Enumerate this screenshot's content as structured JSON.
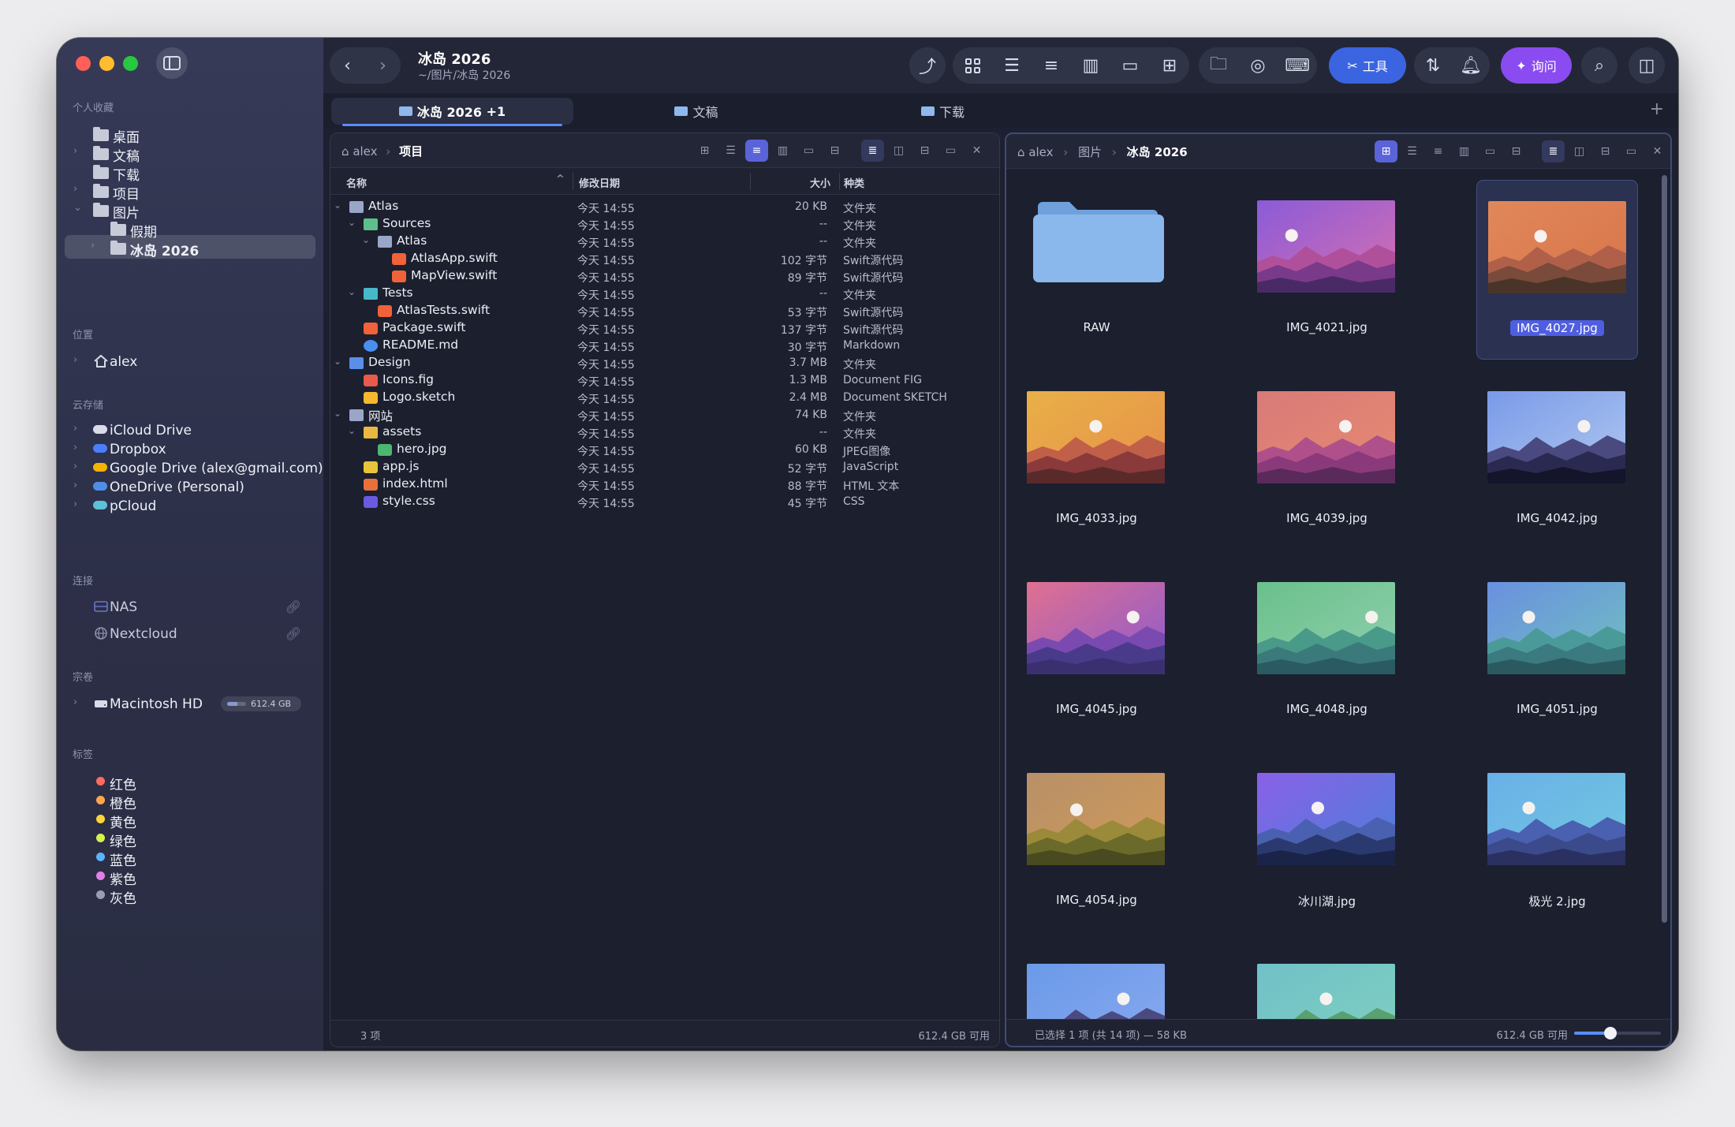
{
  "window": {
    "title": "冰岛 2026",
    "path": "~/图片/冰岛 2026"
  },
  "sidebar": {
    "favorites_header": "个人收藏",
    "favorites": [
      {
        "label": "桌面",
        "chevron": false
      },
      {
        "label": "文稿",
        "chevron": true
      },
      {
        "label": "下载",
        "chevron": false
      },
      {
        "label": "项目",
        "chevron": true
      },
      {
        "label": "图片",
        "chevron": true,
        "expanded": true
      },
      {
        "label": "假期",
        "chevron": false,
        "child": true
      },
      {
        "label": "冰岛 2026",
        "chevron": true,
        "child": true,
        "selected": true
      }
    ],
    "locations_header": "位置",
    "locations": [
      {
        "label": "alex"
      }
    ],
    "cloud_header": "云存储",
    "cloud": [
      {
        "label": "iCloud Drive",
        "icon": "cloud-icon",
        "color": "#d9dce8"
      },
      {
        "label": "Dropbox",
        "icon": "dropbox-icon",
        "color": "#4a7dff"
      },
      {
        "label": "Google Drive (alex@gmail.com)",
        "icon": "google-drive-icon",
        "color": "#f4b400"
      },
      {
        "label": "OneDrive (Personal)",
        "icon": "onedrive-icon",
        "color": "#4f8ee8"
      },
      {
        "label": "pCloud",
        "icon": "pcloud-icon",
        "color": "#5cc0d8"
      }
    ],
    "connections_header": "连接",
    "connections": [
      {
        "label": "NAS",
        "icon": "nas-icon"
      },
      {
        "label": "Nextcloud",
        "icon": "globe-icon"
      }
    ],
    "volumes_header": "宗卷",
    "volumes": [
      {
        "label": "Macintosh HD",
        "capacity": "612.4 GB",
        "usage_fraction": 0.55
      }
    ],
    "tags_header": "标签",
    "tags": [
      {
        "label": "红色",
        "color": "#ff6b5e"
      },
      {
        "label": "橙色",
        "color": "#ffa64d"
      },
      {
        "label": "黄色",
        "color": "#ffd43b"
      },
      {
        "label": "绿色",
        "color": "#d7f24d"
      },
      {
        "label": "蓝色",
        "color": "#5cb2ff"
      },
      {
        "label": "紫色",
        "color": "#e27ee8"
      },
      {
        "label": "灰色",
        "color": "#9a9eb0"
      }
    ]
  },
  "toolbar": {
    "tools_label": "工具",
    "ask_label": "询问",
    "accent_blue": "#3a64e0",
    "accent_purple": "#8a4bf0"
  },
  "tabs": [
    {
      "label": "冰岛 2026",
      "badge": "+1",
      "active": true
    },
    {
      "label": "文稿",
      "active": false
    },
    {
      "label": "下载",
      "active": false
    }
  ],
  "left_pane": {
    "breadcrumb": [
      "alex",
      "项目"
    ],
    "columns": {
      "name": "名称",
      "date": "修改日期",
      "size": "大小",
      "kind": "种类"
    },
    "rows": [
      {
        "depth": 0,
        "expanded": true,
        "icon": "folder",
        "name": "Atlas",
        "date": "今天 14:55",
        "size": "20 KB",
        "kind": "文件夹"
      },
      {
        "depth": 1,
        "expanded": true,
        "icon": "folder-green",
        "name": "Sources",
        "date": "今天 14:55",
        "size": "--",
        "kind": "文件夹"
      },
      {
        "depth": 2,
        "expanded": true,
        "icon": "folder",
        "name": "Atlas",
        "date": "今天 14:55",
        "size": "--",
        "kind": "文件夹"
      },
      {
        "depth": 3,
        "icon": "swift",
        "name": "AtlasApp.swift",
        "date": "今天 14:55",
        "size": "102 字节",
        "kind": "Swift源代码"
      },
      {
        "depth": 3,
        "icon": "swift",
        "name": "MapView.swift",
        "date": "今天 14:55",
        "size": "89 字节",
        "kind": "Swift源代码"
      },
      {
        "depth": 1,
        "expanded": true,
        "icon": "folder-teal",
        "name": "Tests",
        "date": "今天 14:55",
        "size": "--",
        "kind": "文件夹"
      },
      {
        "depth": 2,
        "icon": "swift",
        "name": "AtlasTests.swift",
        "date": "今天 14:55",
        "size": "53 字节",
        "kind": "Swift源代码"
      },
      {
        "depth": 1,
        "icon": "swift",
        "name": "Package.swift",
        "date": "今天 14:55",
        "size": "137 字节",
        "kind": "Swift源代码"
      },
      {
        "depth": 1,
        "icon": "info",
        "name": "README.md",
        "date": "今天 14:55",
        "size": "30 字节",
        "kind": "Markdown"
      },
      {
        "depth": 0,
        "expanded": true,
        "icon": "folder-blue",
        "name": "Design",
        "date": "今天 14:55",
        "size": "3.7 MB",
        "kind": "文件夹"
      },
      {
        "depth": 1,
        "icon": "figma",
        "name": "Icons.fig",
        "date": "今天 14:55",
        "size": "1.3 MB",
        "kind": "Document FIG"
      },
      {
        "depth": 1,
        "icon": "sketch",
        "name": "Logo.sketch",
        "date": "今天 14:55",
        "size": "2.4 MB",
        "kind": "Document SKETCH"
      },
      {
        "depth": 0,
        "expanded": true,
        "icon": "folder",
        "name": "网站",
        "date": "今天 14:55",
        "size": "74 KB",
        "kind": "文件夹"
      },
      {
        "depth": 1,
        "expanded": true,
        "icon": "folder-yellow",
        "name": "assets",
        "date": "今天 14:55",
        "size": "--",
        "kind": "文件夹"
      },
      {
        "depth": 2,
        "icon": "image",
        "name": "hero.jpg",
        "date": "今天 14:55",
        "size": "60 KB",
        "kind": "JPEG图像"
      },
      {
        "depth": 1,
        "icon": "js",
        "name": "app.js",
        "date": "今天 14:55",
        "size": "52 字节",
        "kind": "JavaScript"
      },
      {
        "depth": 1,
        "icon": "html",
        "name": "index.html",
        "date": "今天 14:55",
        "size": "88 字节",
        "kind": "HTML 文本"
      },
      {
        "depth": 1,
        "icon": "css",
        "name": "style.css",
        "date": "今天 14:55",
        "size": "45 字节",
        "kind": "CSS"
      }
    ],
    "status_left": "3 项",
    "status_right": "612.4 GB 可用"
  },
  "right_pane": {
    "breadcrumb": [
      "alex",
      "图片",
      "冰岛 2026"
    ],
    "items": [
      {
        "name": "RAW",
        "type": "folder"
      },
      {
        "name": "IMG_4021.jpg",
        "sky": [
          "#8a5bd8",
          "#d870b0"
        ],
        "hills": [
          "#b0509a",
          "#7a3a8a",
          "#4a2a66"
        ],
        "sun": [
          0.25,
          0.38
        ]
      },
      {
        "name": "IMG_4027.jpg",
        "selected": true,
        "sky": [
          "#e0885a",
          "#d8744a"
        ],
        "hills": [
          "#b06048",
          "#7a4a3a",
          "#4a3428"
        ],
        "sun": [
          0.38,
          0.38
        ]
      },
      {
        "name": "IMG_4033.jpg",
        "sky": [
          "#e8b048",
          "#e89048"
        ],
        "hills": [
          "#c06048",
          "#8a3a3a",
          "#5a2a2a"
        ],
        "sun": [
          0.5,
          0.38
        ]
      },
      {
        "name": "IMG_4039.jpg",
        "sky": [
          "#d87a78",
          "#e88a70"
        ],
        "hills": [
          "#b0508a",
          "#8a3a7a",
          "#5a2a5a"
        ],
        "sun": [
          0.64,
          0.38
        ]
      },
      {
        "name": "IMG_4042.jpg",
        "sky": [
          "#7a9ae8",
          "#b0c8f0"
        ],
        "hills": [
          "#4a4a80",
          "#2a2a50",
          "#14142a"
        ],
        "sun": [
          0.7,
          0.38
        ]
      },
      {
        "name": "IMG_4045.jpg",
        "sky": [
          "#e07090",
          "#8a5ad0"
        ],
        "hills": [
          "#7a4ab0",
          "#4a3a8a",
          "#3a3070"
        ],
        "sun": [
          0.77,
          0.38
        ]
      },
      {
        "name": "IMG_4048.jpg",
        "sky": [
          "#6ac08a",
          "#90d0b0"
        ],
        "hills": [
          "#4a9a8a",
          "#3a7a7a",
          "#2a5a62"
        ],
        "sun": [
          0.83,
          0.38
        ]
      },
      {
        "name": "IMG_4051.jpg",
        "sky": [
          "#6a90e0",
          "#70c0c0"
        ],
        "hills": [
          "#4a9a9a",
          "#3a7a80",
          "#2a5a60"
        ],
        "sun": [
          0.3,
          0.38
        ]
      },
      {
        "name": "IMG_4054.jpg",
        "sky": [
          "#b89068",
          "#d09a58"
        ],
        "hills": [
          "#9a8a3a",
          "#6a6a2a",
          "#4a4a20"
        ],
        "sun": [
          0.36,
          0.4
        ]
      },
      {
        "name": "冰川湖.jpg",
        "sky": [
          "#8a60e8",
          "#4a80d8"
        ],
        "hills": [
          "#4a60b0",
          "#2a3a70",
          "#1a2448"
        ],
        "sun": [
          0.44,
          0.38
        ]
      },
      {
        "name": "极光 2.jpg",
        "sky": [
          "#6ab0e8",
          "#70c8e0"
        ],
        "hills": [
          "#4a60b0",
          "#3a4a8a",
          "#2a3060"
        ],
        "sun": [
          0.3,
          0.38
        ]
      },
      {
        "name": "",
        "sky": [
          "#6a9ae8",
          "#8aa8f0"
        ],
        "hills": [
          "#4a4a80",
          "#2a2a50",
          "#1a1a30"
        ],
        "sun": [
          0.7,
          0.38
        ]
      },
      {
        "name": "",
        "sky": [
          "#70c0c8",
          "#80d0c0"
        ],
        "hills": [
          "#5aa070",
          "#3a8050",
          "#2a6040"
        ],
        "sun": [
          0.5,
          0.38
        ]
      }
    ],
    "status_left": "已选择 1 项 (共 14 项) — 58 KB",
    "status_right": "612.4 GB 可用",
    "zoom_fraction": 0.42
  }
}
